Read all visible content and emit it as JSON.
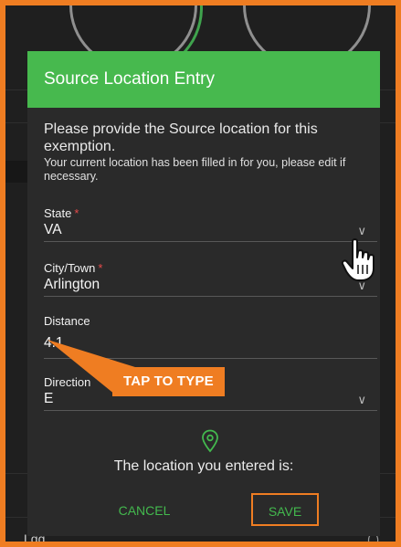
{
  "dialog": {
    "title": "Source Location Entry",
    "intro": "Please provide the Source location for this exemption.",
    "note": "Your current location has been filled in for you, please edit if necessary."
  },
  "fields": {
    "state": {
      "label": "State",
      "required_mark": "*",
      "value": "VA"
    },
    "city": {
      "label": "City/Town",
      "required_mark": "*",
      "value": "Arlington"
    },
    "distance": {
      "label": "Distance",
      "value": "4.1"
    },
    "direction": {
      "label": "Direction",
      "value": "E"
    }
  },
  "location_text": "The location you entered is:",
  "buttons": {
    "cancel": "CANCEL",
    "save": "SAVE"
  },
  "callout": "TAP TO TYPE",
  "background": {
    "bottom_text": "Lgg"
  },
  "icons": {
    "chevron": "chevron-down-icon",
    "pin": "map-pin-icon",
    "cursor": "hand-pointer-icon"
  },
  "colors": {
    "header": "#47b94e",
    "accent_orange": "#ef7d22",
    "button_text": "#43b94e",
    "required": "#e74b4b",
    "dialog_bg": "#2a2a2a"
  }
}
